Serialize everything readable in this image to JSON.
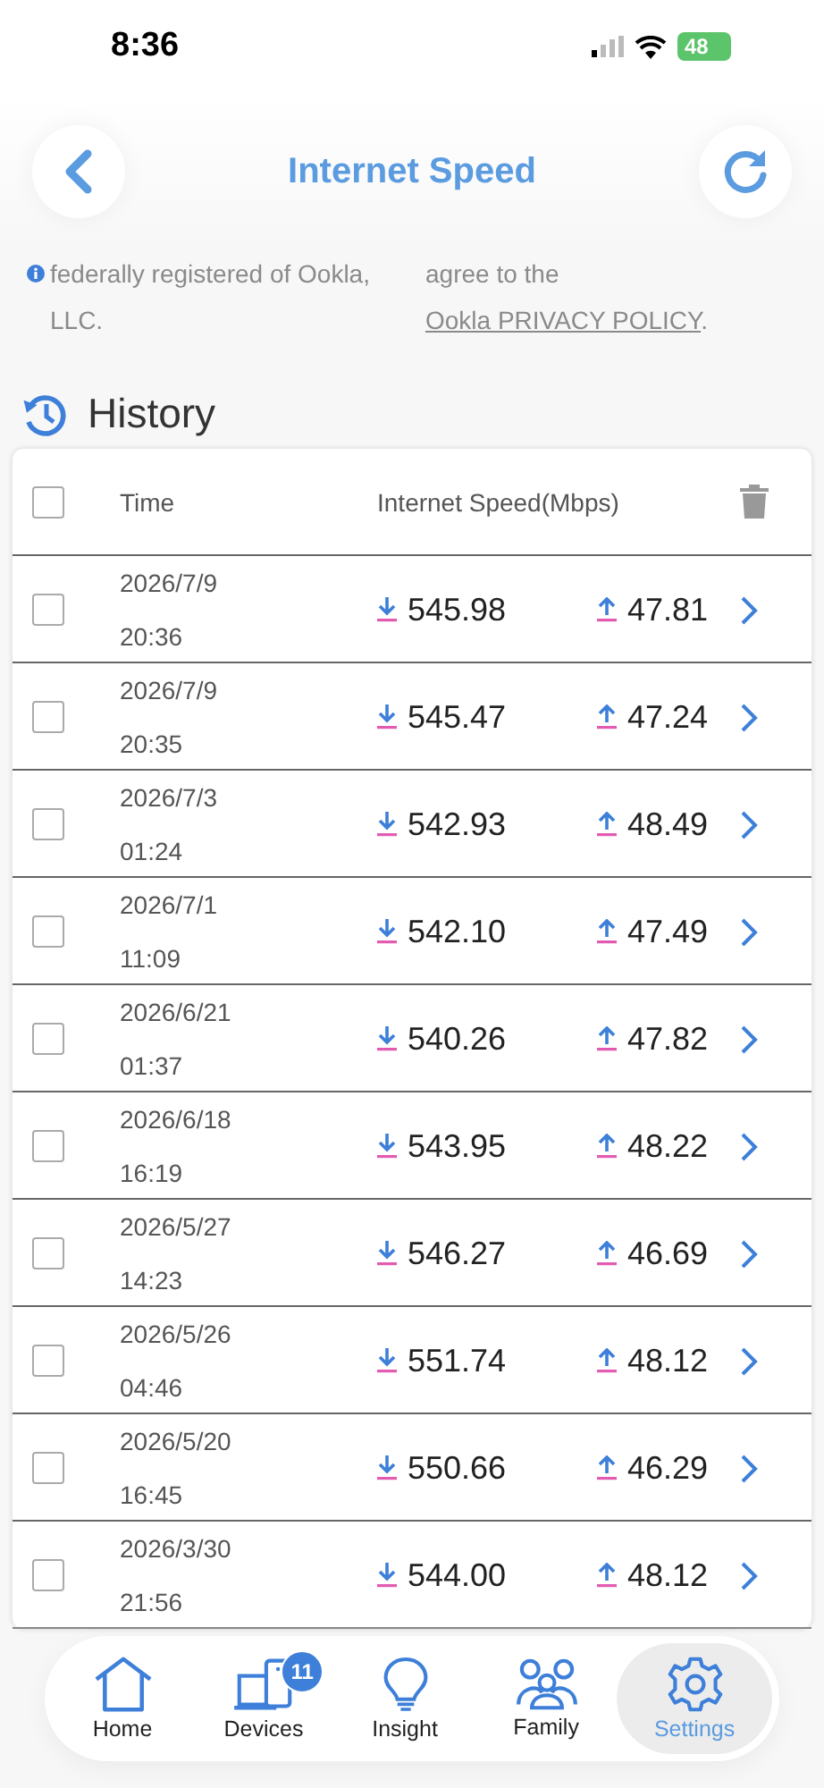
{
  "status_bar": {
    "time": "8:36",
    "battery": "48"
  },
  "header": {
    "title": "Internet Speed"
  },
  "disclaimer": {
    "left": "federally registered of Ookla, LLC.",
    "right_prefix": "agree to the ",
    "right_link": "Ookla PRIVACY POLICY",
    "right_suffix": "."
  },
  "history": {
    "title": "History"
  },
  "table": {
    "select_all_checked": false,
    "columns": [
      "Time",
      "Internet Speed(Mbps)"
    ],
    "rows": [
      {
        "date": "2026/7/9",
        "time": "20:36",
        "download": "545.98",
        "upload": "47.81",
        "checked": false
      },
      {
        "date": "2026/7/9",
        "time": "20:35",
        "download": "545.47",
        "upload": "47.24",
        "checked": false
      },
      {
        "date": "2026/7/3",
        "time": "01:24",
        "download": "542.93",
        "upload": "48.49",
        "checked": false
      },
      {
        "date": "2026/7/1",
        "time": "11:09",
        "download": "542.10",
        "upload": "47.49",
        "checked": false
      },
      {
        "date": "2026/6/21",
        "time": "01:37",
        "download": "540.26",
        "upload": "47.82",
        "checked": false
      },
      {
        "date": "2026/6/18",
        "time": "16:19",
        "download": "543.95",
        "upload": "48.22",
        "checked": false
      },
      {
        "date": "2026/5/27",
        "time": "14:23",
        "download": "546.27",
        "upload": "46.69",
        "checked": false
      },
      {
        "date": "2026/5/26",
        "time": "04:46",
        "download": "551.74",
        "upload": "48.12",
        "checked": false
      },
      {
        "date": "2026/5/20",
        "time": "16:45",
        "download": "550.66",
        "upload": "46.29",
        "checked": false
      },
      {
        "date": "2026/3/30",
        "time": "21:56",
        "download": "544.00",
        "upload": "48.12",
        "checked": false
      }
    ]
  },
  "tab_bar": [
    {
      "kind": "home",
      "label": "Home",
      "selected": false
    },
    {
      "kind": "devices",
      "label": "Devices",
      "selected": false,
      "badge": "11"
    },
    {
      "kind": "insight",
      "label": "Insight",
      "selected": false
    },
    {
      "kind": "family",
      "label": "Family",
      "selected": false
    },
    {
      "kind": "settings",
      "label": "Settings",
      "selected": true
    }
  ]
}
